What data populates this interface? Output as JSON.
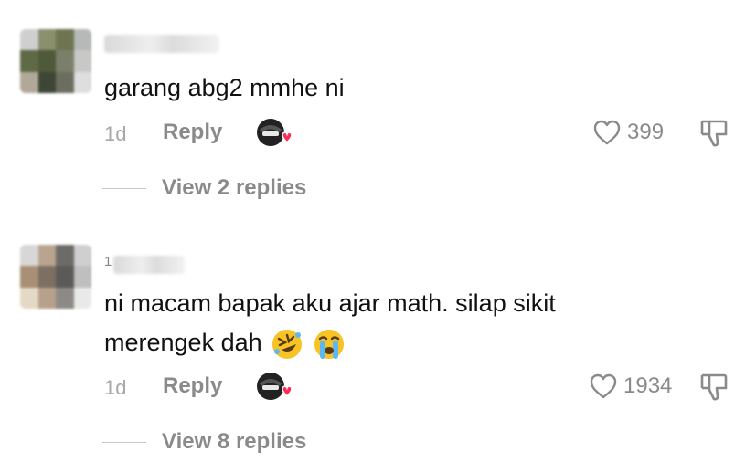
{
  "comments": [
    {
      "username_prefix": "",
      "text_lines": [
        "garang abg2 mmhe ni"
      ],
      "age": "1d",
      "reply_label": "Reply",
      "likes": "399",
      "view_replies": "View 2 replies",
      "emojis": []
    },
    {
      "username_prefix": "1",
      "text_lines": [
        "ni macam bapak aku ajar math. silap sikit",
        "merengek dah"
      ],
      "age": "1d",
      "reply_label": "Reply",
      "likes": "1934",
      "view_replies": "View 8 replies",
      "emojis": [
        "rolling-on-floor-laughing",
        "loudly-crying"
      ]
    }
  ],
  "colors": {
    "meta_gray": "#8a8a8a",
    "heart_red": "#fe2c55",
    "text": "#111111"
  }
}
